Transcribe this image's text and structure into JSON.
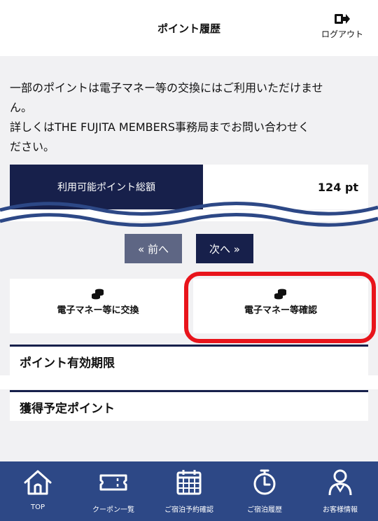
{
  "header": {
    "title": "ポイント履歴",
    "logout_label": "ログアウト"
  },
  "notice": {
    "line1": "一部のポイントは電子マネー等の交換にはご利用いただけませ",
    "line2": "ん。",
    "line3": "詳しくはTHE FUJITA MEMBERS事務局までお問い合わせく",
    "line4": "ださい。"
  },
  "points": {
    "label": "利用可能ポイント総額",
    "value": "124 pt"
  },
  "pager": {
    "prev_label": "« 前へ",
    "next_label": "次へ »"
  },
  "actions": {
    "exchange_label": "電子マネー等に交換",
    "confirm_label": "電子マネー等確認"
  },
  "sections": {
    "expiry_title": "ポイント有効期限",
    "planned_title": "獲得予定ポイント"
  },
  "nav": {
    "items": [
      {
        "label": "TOP",
        "icon": "home-icon"
      },
      {
        "label": "クーポン一覧",
        "icon": "ticket-icon"
      },
      {
        "label": "ご宿泊予約確認",
        "icon": "calendar-icon"
      },
      {
        "label": "ご宿泊履歴",
        "icon": "stopwatch-icon"
      },
      {
        "label": "お客様情報",
        "icon": "person-icon"
      }
    ]
  },
  "colors": {
    "navy": "#17204b",
    "nav_bar": "#2d4886",
    "prev_button": "#5e6684",
    "highlight": "#e8141b",
    "wave": "#2d4886"
  }
}
